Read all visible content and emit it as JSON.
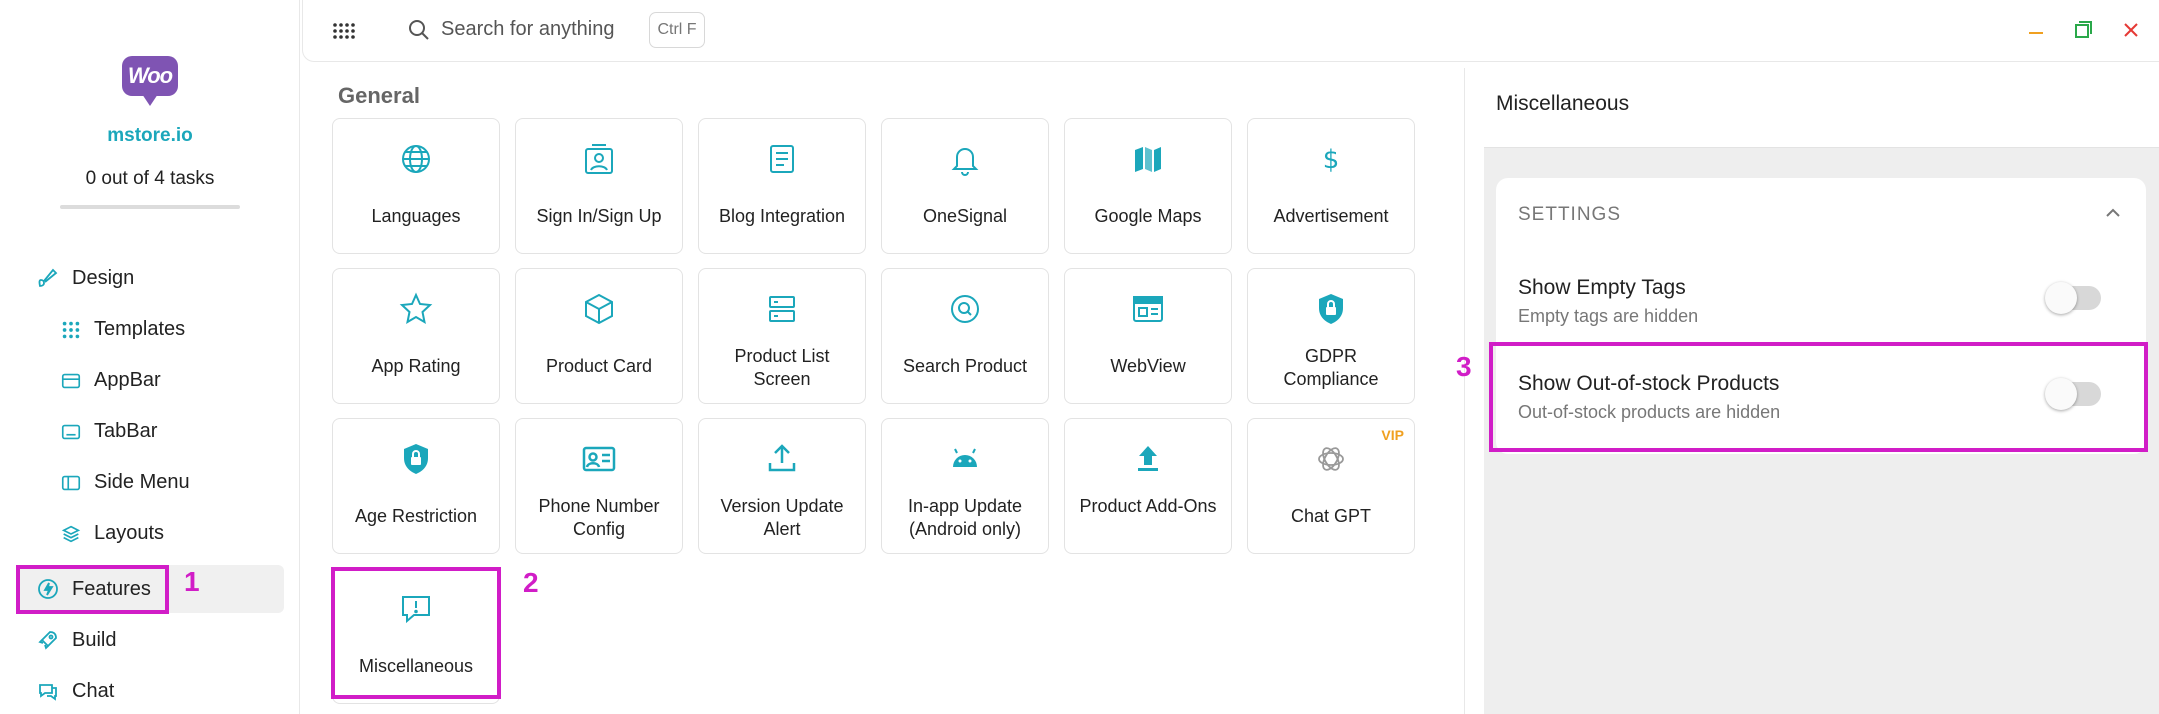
{
  "sidebar": {
    "logo_text": "Woo",
    "store_name": "mstore.io",
    "tasks": "0 out of 4 tasks",
    "task_progress": 0,
    "items": [
      {
        "label": "Design"
      },
      {
        "label": "Templates"
      },
      {
        "label": "AppBar"
      },
      {
        "label": "TabBar"
      },
      {
        "label": "Side Menu"
      },
      {
        "label": "Layouts"
      },
      {
        "label": "Features"
      },
      {
        "label": "Build"
      },
      {
        "label": "Chat"
      }
    ]
  },
  "topbar": {
    "search_placeholder": "Search for anything",
    "shortcut": "Ctrl F"
  },
  "main": {
    "section_title": "General",
    "cards": [
      {
        "label": "Languages",
        "icon": "globe-icon"
      },
      {
        "label": "Sign In/Sign Up",
        "icon": "user-card-icon"
      },
      {
        "label": "Blog Integration",
        "icon": "document-icon"
      },
      {
        "label": "OneSignal",
        "icon": "bell-icon"
      },
      {
        "label": "Google Maps",
        "icon": "map-icon"
      },
      {
        "label": "Advertisement",
        "icon": "dollar-icon"
      },
      {
        "label": "App Rating",
        "icon": "star-icon"
      },
      {
        "label": "Product Card",
        "icon": "box-icon"
      },
      {
        "label": "Product List Screen",
        "icon": "server-list-icon"
      },
      {
        "label": "Search Product",
        "icon": "search-circle-icon"
      },
      {
        "label": "WebView",
        "icon": "browser-icon"
      },
      {
        "label": "GDPR Compliance",
        "icon": "shield-lock-icon"
      },
      {
        "label": "Age Restriction",
        "icon": "shield-lock-icon"
      },
      {
        "label": "Phone Number Config",
        "icon": "contact-card-icon"
      },
      {
        "label": "Version Update Alert",
        "icon": "upload-icon"
      },
      {
        "label": "In-app Update (Android only)",
        "icon": "android-icon"
      },
      {
        "label": "Product Add-Ons",
        "icon": "upload-arrow-icon"
      },
      {
        "label": "Chat GPT",
        "icon": "openai-icon",
        "badge": "VIP"
      },
      {
        "label": "Miscellaneous",
        "icon": "alert-chat-icon"
      }
    ]
  },
  "right": {
    "title": "Miscellaneous",
    "settings_header": "SETTINGS",
    "rows": [
      {
        "title": "Show Empty Tags",
        "subtitle": "Empty tags are hidden",
        "enabled": false
      },
      {
        "title": "Show Out-of-stock Products",
        "subtitle": "Out-of-stock products are hidden",
        "enabled": false
      }
    ]
  },
  "annotations": [
    "1",
    "2",
    "3"
  ],
  "colors": {
    "accent": "#1ba7bb",
    "highlight": "#d11dc7",
    "vip": "#f0a020",
    "woo": "#7f54b3"
  }
}
